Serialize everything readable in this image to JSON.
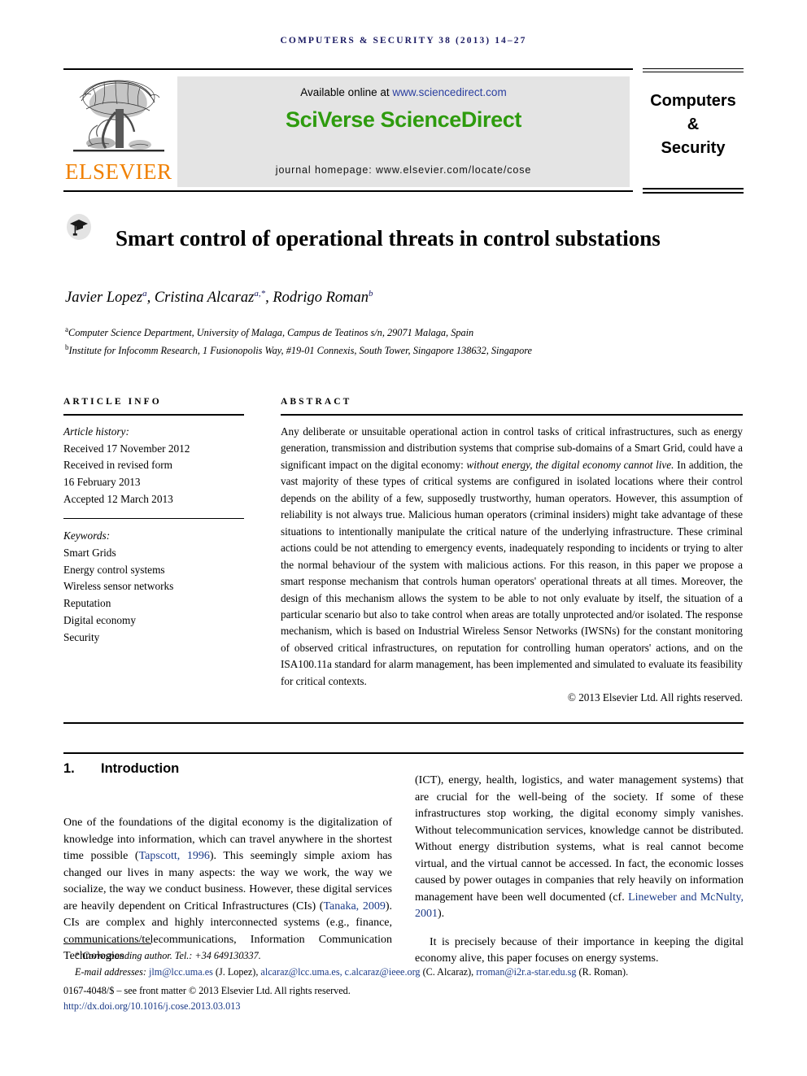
{
  "running_head": "Computers & Security 38 (2013) 14–27",
  "masthead": {
    "available_prefix": "Available online at ",
    "available_link": "www.sciencedirect.com",
    "logo": "SciVerse ScienceDirect",
    "homepage": "journal homepage: www.elsevier.com/locate/cose",
    "publisher": "ELSEVIER",
    "journal_title_lines": [
      "Computers",
      "&",
      "Security"
    ],
    "colors": {
      "logo_green": "#2e9b0e",
      "link_blue": "#2b3fa0",
      "elsevier_orange": "#f08000",
      "box_gray": "#e4e4e4"
    }
  },
  "article": {
    "title": "Smart control of operational threats in control substations",
    "authors_html": "Javier Lopez <sup>a</sup>, Cristina Alcaraz <sup>a,*</sup>, Rodrigo Roman <sup>b</sup>",
    "affiliations": [
      "Computer Science Department, University of Malaga, Campus de Teatinos s/n, 29071 Malaga, Spain",
      "Institute for Infocomm Research, 1 Fusionopolis Way, #19-01 Connexis, South Tower, Singapore 138632, Singapore"
    ],
    "affiliation_marks": [
      "a",
      "b"
    ]
  },
  "article_info": {
    "label": "ARTICLE INFO",
    "history_heading": "Article history:",
    "history": [
      "Received 17 November 2012",
      "Received in revised form",
      "16 February 2013",
      "Accepted 12 March 2013"
    ],
    "keywords_heading": "Keywords:",
    "keywords": [
      "Smart Grids",
      "Energy control systems",
      "Wireless sensor networks",
      "Reputation",
      "Digital economy",
      "Security"
    ]
  },
  "abstract": {
    "label": "ABSTRACT",
    "part1": "Any deliberate or unsuitable operational action in control tasks of critical infrastructures, such as energy generation, transmission and distribution systems that comprise sub-domains of a Smart Grid, could have a significant impact on the digital economy: ",
    "italic": "without energy, the digital economy cannot live.",
    "part2": " In addition, the vast majority of these types of critical systems are configured in isolated locations where their control depends on the ability of a few, supposedly trustworthy, human operators. However, this assumption of reliability is not always true. Malicious human operators (criminal insiders) might take advantage of these situations to intentionally manipulate the critical nature of the underlying infrastructure. These criminal actions could be not attending to emergency events, inadequately responding to incidents or trying to alter the normal behaviour of the system with malicious actions. For this reason, in this paper we propose a smart response mechanism that controls human operators' operational threats at all times. Moreover, the design of this mechanism allows the system to be able to not only evaluate by itself, the situation of a particular scenario but also to take control when areas are totally unprotected and/or isolated. The response mechanism, which is based on Industrial Wireless Sensor Networks (IWSNs) for the constant monitoring of observed critical infrastructures, on reputation for controlling human operators' actions, and on the ISA100.11a standard for alarm management, has been implemented and simulated to evaluate its feasibility for critical contexts.",
    "copyright": "© 2013 Elsevier Ltd. All rights reserved."
  },
  "body": {
    "section_number": "1.",
    "section_title": "Introduction",
    "left_para_1": "One of the foundations of the digital economy is the digitalization of knowledge into information, which can travel anywhere in the shortest time possible (",
    "left_ref_1": "Tapscott, 1996",
    "left_para_1b": "). This seemingly simple axiom has changed our lives in many aspects: the way we work, the way we socialize, the way we conduct business. However, these digital services are heavily dependent on Critical Infrastructures (CIs) (",
    "left_ref_2": "Tanaka, 2009",
    "left_para_1c": "). CIs are complex and highly interconnected systems (e.g., finance, communications/telecommunications, Information Communication Technologies",
    "right_para_1": "(ICT), energy, health, logistics, and water management systems) that are crucial for the well-being of the society. If some of these infrastructures stop working, the digital economy simply vanishes. Without telecommunication services, knowledge cannot be distributed. Without energy distribution systems, what is real cannot become virtual, and the virtual cannot be accessed. In fact, the economic losses caused by power outages in companies that rely heavily on information management have been well documented (cf. ",
    "right_ref_1": "Lineweber and McNulty, 2001",
    "right_para_1b": ").",
    "right_para_2": "It is precisely because of their importance in keeping the digital economy alive, this paper focuses on energy systems."
  },
  "footnotes": {
    "corresponding_star": "*",
    "corresponding": "Corresponding author. Tel.: +34 649130337.",
    "email_label": "E-mail addresses:",
    "emails": [
      {
        "addr": "jlm@lcc.uma.es",
        "who": "(J. Lopez),"
      },
      {
        "addr": "alcaraz@lcc.uma.es,",
        "who": ""
      },
      {
        "addr": "c.alcaraz@ieee.org",
        "who": "(C. Alcaraz),"
      },
      {
        "addr": "rroman@i2r.a-star.edu.sg",
        "who": "(R. Roman)."
      }
    ],
    "front_matter": "0167-4048/$ – see front matter © 2013 Elsevier Ltd. All rights reserved.",
    "doi": "http://dx.doi.org/10.1016/j.cose.2013.03.013"
  }
}
